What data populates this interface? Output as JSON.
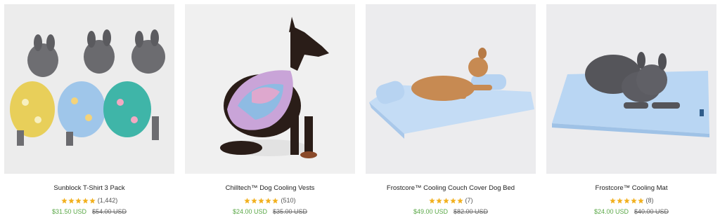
{
  "colors": {
    "star": "#f2b01e",
    "sale_price": "#58a745",
    "image_bg": "#ededed"
  },
  "products": [
    {
      "title": "Sunblock T-Shirt 3 Pack",
      "reviews": "(1,442)",
      "sale_price": "$31.50 USD",
      "original_price": "$54.00 USD",
      "rating": 5
    },
    {
      "title": "Chilltech™ Dog Cooling Vests",
      "reviews": "(510)",
      "sale_price": "$24.00 USD",
      "original_price": "$35.00 USD",
      "rating": 5
    },
    {
      "title": "Frostcore™ Cooling Couch Cover Dog Bed",
      "reviews": "(7)",
      "sale_price": "$49.00 USD",
      "original_price": "$82.00 USD",
      "rating": 5
    },
    {
      "title": "Frostcore™ Cooling Mat",
      "reviews": "(8)",
      "sale_price": "$24.00 USD",
      "original_price": "$40.00 USD",
      "rating": 5
    }
  ]
}
